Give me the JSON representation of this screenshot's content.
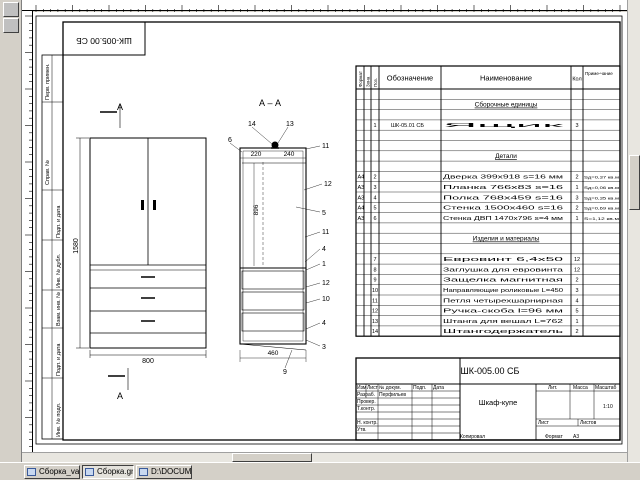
{
  "drawing": {
    "stamp_top_rotated": "ШК-005.00 СБ",
    "side_strip_labels": [
      "Перв. примен.",
      "Справ. №",
      "Подп. и дата",
      "Инв. № дубл.",
      "Взам. инв. №",
      "Подп. и дата",
      "Инв. № подл."
    ],
    "front_view": {
      "section_mark": "А",
      "dim_height": "1580",
      "dim_width": "800"
    },
    "section_view": {
      "title": "А – А",
      "dim_depth": "460",
      "dim_top_left": "220",
      "dim_top_right": "240",
      "dim_vertical": "896",
      "callouts_left": [
        "6",
        "14",
        "13"
      ],
      "callouts_right": [
        "11",
        "12",
        "5",
        "11",
        "4",
        "1",
        "12",
        "10",
        "4",
        "3"
      ],
      "callout_bottom": "9"
    },
    "spec_table": {
      "headers": [
        "Формат",
        "Зона",
        "Поз.",
        "Обозначение",
        "Наименование",
        "Кол",
        "Приме-чание"
      ],
      "sections": [
        {
          "title": "Сборочные единицы",
          "rows": [
            {
              "fmt": "",
              "zone": "",
              "pos": "1",
              "designation": "ШК-05.01 СБ",
              "name": "Ящик",
              "qty": "3",
              "note": ""
            }
          ]
        },
        {
          "title": "Детали",
          "rows": [
            {
              "fmt": "А4",
              "zone": "",
              "pos": "2",
              "designation": "",
              "name": "Дверка 399х918 s=16 мм",
              "qty": "2",
              "note": "Sд=0,37 кв.м"
            },
            {
              "fmt": "А3",
              "zone": "",
              "pos": "3",
              "designation": "",
              "name": "Планка 766х83 s=16",
              "qty": "1",
              "note": "Sд=0,06 кв.м"
            },
            {
              "fmt": "А3",
              "zone": "",
              "pos": "4",
              "designation": "",
              "name": "Полка 768х459 s=16",
              "qty": "3",
              "note": "Sд=0,35 кв.м"
            },
            {
              "fmt": "А4",
              "zone": "",
              "pos": "5",
              "designation": "",
              "name": "Стенка 1500х460 s=16",
              "qty": "2",
              "note": "Sд=0,69 кв.м"
            },
            {
              "fmt": "А3",
              "zone": "",
              "pos": "6",
              "designation": "",
              "name": "Стенка ДВП 1470х796 s=4 мм",
              "qty": "1",
              "note": "S=1,12 кв.м"
            }
          ]
        },
        {
          "title": "Изделия и материалы",
          "rows": [
            {
              "fmt": "",
              "zone": "",
              "pos": "7",
              "designation": "",
              "name": "Евровинт 6,4х50",
              "qty": "12",
              "note": ""
            },
            {
              "fmt": "",
              "zone": "",
              "pos": "8",
              "designation": "",
              "name": "Заглушка для евровинта",
              "qty": "12",
              "note": ""
            },
            {
              "fmt": "",
              "zone": "",
              "pos": "9",
              "designation": "",
              "name": "Защелка магнитная",
              "qty": "2",
              "note": ""
            },
            {
              "fmt": "",
              "zone": "",
              "pos": "10",
              "designation": "",
              "name": "Направляющие роликовые L=450",
              "qty": "3",
              "note": ""
            },
            {
              "fmt": "",
              "zone": "",
              "pos": "11",
              "designation": "",
              "name": "Петля четырехшарнирная",
              "qty": "4",
              "note": ""
            },
            {
              "fmt": "",
              "zone": "",
              "pos": "12",
              "designation": "",
              "name": "Ручка-скоба l=96 мм",
              "qty": "5",
              "note": ""
            },
            {
              "fmt": "",
              "zone": "",
              "pos": "13",
              "designation": "",
              "name": "Штанга для вешал L=762",
              "qty": "1",
              "note": ""
            },
            {
              "fmt": "",
              "zone": "",
              "pos": "14",
              "designation": "",
              "name": "Штангодержатель",
              "qty": "2",
              "note": ""
            }
          ]
        }
      ]
    },
    "title_block": {
      "code": "ШК-005.00 СБ",
      "name": "Шкаф-купе",
      "labels": {
        "izm": "Изм",
        "list": "Лист",
        "doc": "№ докум.",
        "sign": "Подп.",
        "date": "Дата",
        "razrab": "Разраб.",
        "prov": "Провер.",
        "tkontr": "Т.контр.",
        "nkontr": "Н. контр.",
        "utv": "Утв.",
        "lit": "Лит.",
        "massa": "Масса",
        "masshtab": "Масштаб",
        "listov": "Листов",
        "kopiroval": "Копировал",
        "format": "Формат",
        "format_value": "А3"
      },
      "razrab_name": "Перфильев",
      "scale": "1:10"
    }
  },
  "taskbar": {
    "items": [
      {
        "label": "Сборка_var...",
        "active": false
      },
      {
        "label": "Сборка.grb",
        "active": true
      },
      {
        "label": "D:\\DOCUM...",
        "active": false
      }
    ]
  }
}
